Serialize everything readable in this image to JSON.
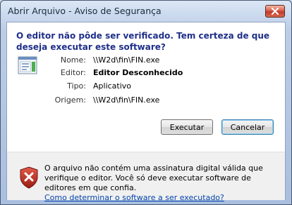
{
  "window": {
    "title": "Abrir Arquivo - Aviso de Segurança"
  },
  "dialog": {
    "heading": "O editor não pôde ser verificado.  Tem certeza de que deseja executar este software?",
    "fields": [
      {
        "label": "Nome:",
        "value": "\\\\W2d\\fin\\FIN.exe",
        "bold": false
      },
      {
        "label": "Editor:",
        "value": "Editor Desconhecido",
        "bold": true
      },
      {
        "label": "Tipo:",
        "value": "Aplicativo",
        "bold": false
      },
      {
        "label": "Origem:",
        "value": "\\\\W2d\\fin\\FIN.exe",
        "bold": false
      }
    ],
    "buttons": {
      "run": "Executar",
      "cancel": "Cancelar"
    }
  },
  "footer": {
    "message": "O arquivo não contém uma assinatura digital válida que verifique o editor. Você só deve executar software de editores em que confia.",
    "link": "Como determinar o software a ser executado?"
  },
  "icons": {
    "app": "application-icon",
    "warning": "security-shield-icon",
    "close": "close-icon"
  }
}
